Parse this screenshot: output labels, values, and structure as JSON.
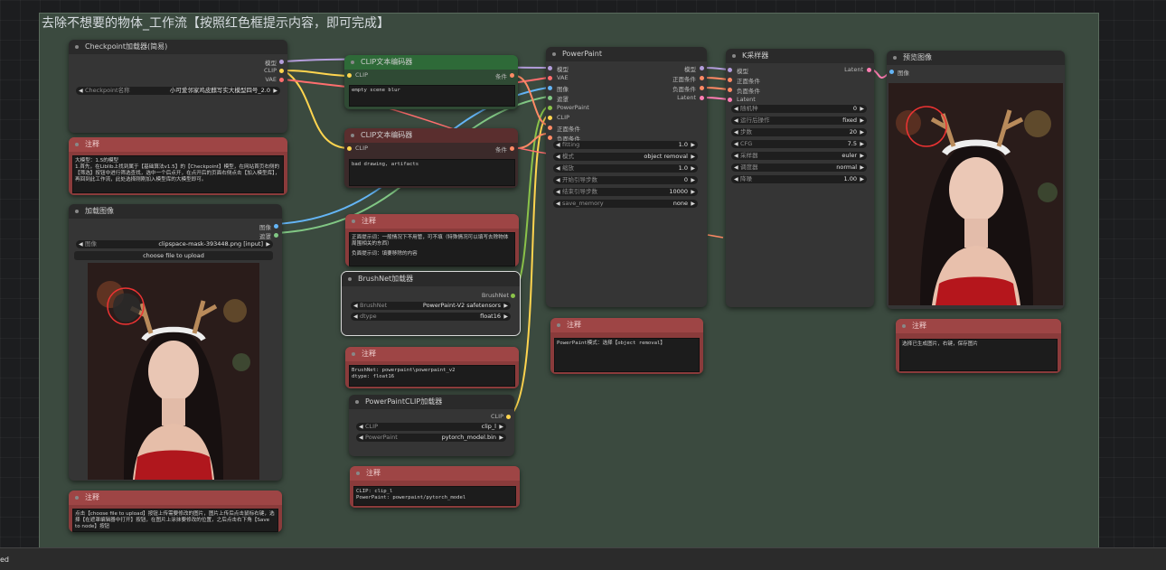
{
  "group": {
    "title": "去除不想要的物体_工作流【按照红色框提示内容，即可完成】"
  },
  "nodes": {
    "checkpoint": {
      "title": "Checkpoint加载器(简易)",
      "outputs": [
        "模型",
        "CLIP",
        "VAE"
      ],
      "widget": {
        "label": "Checkpoint名称",
        "value": "小可爱邻家鸡皮麒写实大模型四号_2.0"
      }
    },
    "note1": {
      "title": "注释",
      "lines": [
        "大模型：1.5的模型",
        "1.首先，在Liblib上找到属于【基础算法v1.5】的【Checkpoint】模型，在网站首页右侧的【筛选】按钮中进行筛选查找，选中一个后点开，在点开后的页面右侧点击【加入模型库】，再回到此工作流，此处选择刚刚加入模型库的大模型即可。"
      ]
    },
    "loadimage": {
      "title": "加载图像",
      "outputs": [
        "图像",
        "遮罩"
      ],
      "widget": {
        "label": "图像",
        "value": "clipspace-mask-393448.png [input]"
      },
      "button": "choose file to upload"
    },
    "note2": {
      "title": "注释",
      "lines": [
        "点击【choose file to upload】按钮上传需要修改的图片，图片上传后点击鼠标右键，选择【在遮罩编辑器中打开】按钮，在图片上涂抹要修改的位置，之后点击右下角【Save to node】按钮"
      ]
    },
    "clip_pos": {
      "title": "CLIP文本编码器",
      "input": "CLIP",
      "output": "条件",
      "text": "empty scene blur"
    },
    "clip_neg": {
      "title": "CLIP文本编码器",
      "input": "CLIP",
      "output": "条件",
      "text": "bad drawing, artifacts"
    },
    "note3": {
      "title": "注释",
      "lines": [
        "正面提示词：一般情况下不用管，可不填（特殊情况可以填写去除物体周围相关的东西）",
        "负面提示词：填要移除的内容"
      ]
    },
    "brushnet": {
      "title": "BrushNet加载器",
      "output": "BrushNet",
      "widgets": [
        {
          "label": "BrushNet",
          "value": "PowerPaint-V2 safetensors"
        },
        {
          "label": "dtype",
          "value": "float16"
        }
      ]
    },
    "note4": {
      "title": "注释",
      "lines": [
        "BrushNet: powerpaint\\powerpaint_v2",
        "dtype:     float16"
      ]
    },
    "ppclip": {
      "title": "PowerPaintCLIP加载器",
      "output": "CLIP",
      "widgets": [
        {
          "label": "CLIP",
          "value": "clip_l"
        },
        {
          "label": "PowerPaint",
          "value": "pytorch_model.bin"
        }
      ]
    },
    "note5": {
      "title": "注释",
      "lines": [
        "CLIP: clip_l",
        "PowerPaint: powerpaint/pytorch_model"
      ]
    },
    "powerpaint": {
      "title": "PowerPaint",
      "inputs": [
        "模型",
        "VAE",
        "图像",
        "遮罩",
        "PowerPaint",
        "CLIP",
        "正面条件",
        "负面条件"
      ],
      "outputs": [
        "模型",
        "正面条件",
        "负面条件",
        "Latent"
      ],
      "widgets": [
        {
          "label": "fitting",
          "value": "1.0"
        },
        {
          "label": "模式",
          "value": "object removal"
        },
        {
          "label": "缩放",
          "value": "1.0"
        },
        {
          "label": "开始引导步数",
          "value": "0"
        },
        {
          "label": "结束引导步数",
          "value": "10000"
        },
        {
          "label": "save_memory",
          "value": "none"
        }
      ]
    },
    "note6": {
      "title": "注释",
      "lines": [
        "PowerPaint模式：选择【object removal】"
      ]
    },
    "ksampler": {
      "title": "K采样器",
      "inputs": [
        "模型",
        "正面条件",
        "负面条件",
        "Latent"
      ],
      "output": "Latent",
      "widgets": [
        {
          "label": "随机种",
          "value": "0"
        },
        {
          "label": "运行后操作",
          "value": "fixed"
        },
        {
          "label": "步数",
          "value": "20"
        },
        {
          "label": "CFG",
          "value": "7.5"
        },
        {
          "label": "采样器",
          "value": "euler"
        },
        {
          "label": "调度器",
          "value": "normal"
        },
        {
          "label": "降噪",
          "value": "1.00"
        }
      ]
    },
    "preview": {
      "title": "预览图像",
      "input": "图像"
    },
    "note7": {
      "title": "注释",
      "lines": [
        "选择已生成图片，右键，保存图片"
      ]
    }
  },
  "bottombar": {
    "tag": "ed"
  }
}
